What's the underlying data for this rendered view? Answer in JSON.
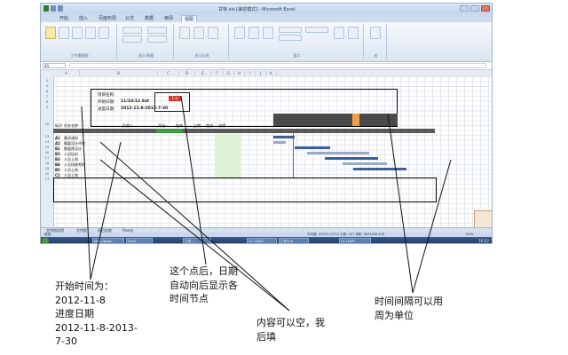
{
  "window": {
    "title": "甘特.xls [兼容模式] - Microsoft Excel",
    "tabs": [
      "开始",
      "插入",
      "页面布局",
      "公式",
      "数据",
      "审阅",
      "视图"
    ],
    "active_tab": "视图",
    "ribbon_groups": [
      "工作簿视图",
      "显示/隐藏",
      "显示比例",
      "窗口",
      "宏"
    ],
    "ribbon_buttons": [
      "普通",
      "页面布局",
      "分页预览",
      "自定义视图",
      "全屏显示",
      "显示比例",
      "100%",
      "缩放到选定区域",
      "新建窗口",
      "全部重排",
      "冻结窗格",
      "拆分",
      "隐藏",
      "取消隐藏",
      "保存工作区",
      "切换窗口",
      "宏"
    ],
    "name_box": "A1"
  },
  "sheet": {
    "project_label": "项目名称:",
    "start_label": "开始日期:",
    "start_value": "11/10/12 Sat",
    "progress_label": "进度日期:",
    "progress_value": "2012-11-8-2013-7-30",
    "red_value": "1 w",
    "headers": [
      "标识",
      "任务名称",
      "负责人",
      "开始",
      "结束",
      "工期",
      "完成",
      "说明"
    ],
    "rows": [
      {
        "id": "A1",
        "name": "需求调研"
      },
      {
        "id": "A2",
        "name": "概要设计评审"
      },
      {
        "id": "B1",
        "name": "数据库设计"
      },
      {
        "id": "B2",
        "name": "人员培训"
      },
      {
        "id": "B3",
        "name": "人员上岗"
      },
      {
        "id": "B4",
        "name": "人员技能考核"
      },
      {
        "id": "B5",
        "name": "人员上岗"
      },
      {
        "id": "C1",
        "name": "人员上岗"
      }
    ],
    "sheet_tabs": [
      "甘特图说明",
      "甘特图",
      "项目进度",
      "Ready"
    ],
    "status_left": "就绪",
    "status_right": "平均值: 29702.23712   计数: 257   求和: 5825438.476",
    "zoom": "100%",
    "clock": "16:22"
  },
  "taskbar": {
    "items": [
      "http://www...",
      "Excel",
      "工作...",
      "11.11IAPI",
      "工作2(3)",
      "11.11API"
    ]
  },
  "callouts": {
    "start_time": "开始时间为：\n2012-11-8\n进度日期\n2012-11-8-2013-\n7-30",
    "after_point": "这个点后，日期\n自动向后显示各\n时间节点",
    "content_blank": "内容可以空，我\n后填",
    "interval": "时间间隔可以用\n周为单位"
  },
  "colors": {
    "accent": "#d13b2f",
    "gantt_bar": "#3d5e9c",
    "gantt_light": "#9aa9c4"
  }
}
